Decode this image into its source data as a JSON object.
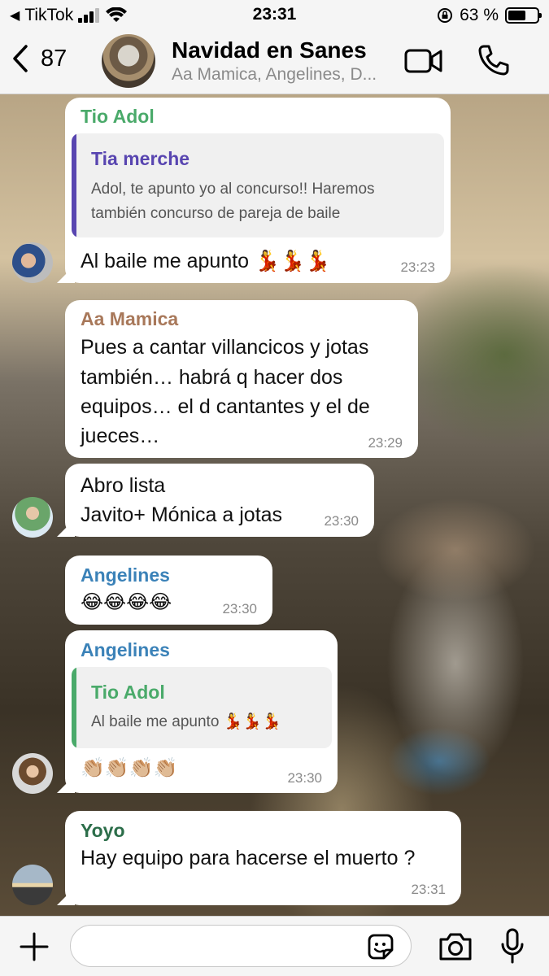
{
  "status_bar": {
    "back_app": "TikTok",
    "time": "23:31",
    "battery": "63 %",
    "battery_level": 0.63
  },
  "header": {
    "unread_count": "87",
    "title": "Navidad en Sanes",
    "subtitle": "Aa Mamica, Angelines, D..."
  },
  "colors": {
    "tio_adol": "#4aaa6a",
    "tia_merche": "#5845b0",
    "aa_mamica": "#a8785a",
    "angelines": "#3b82b8",
    "yoyo": "#2c6e4a"
  },
  "messages": [
    {
      "sender": "Tio Adol",
      "quote_sender": "Tia merche",
      "quote_text_1": "Adol, te apunto yo al concurso!! Haremos",
      "quote_text_2": "también concurso de pareja de baile",
      "text": "Al baile me apunto 💃💃💃",
      "time": "23:23"
    },
    {
      "sender": "Aa Mamica",
      "line_1": "Pues a cantar villancicos y jotas",
      "line_2": "también… habrá q hacer dos",
      "line_3": "equipos… el d cantantes y el de",
      "line_4": "jueces…",
      "time": "23:29"
    },
    {
      "line_1": "Abro lista",
      "line_2": "Javito+ Mónica a jotas",
      "time": "23:30"
    },
    {
      "sender": "Angelines",
      "text": "😂😂😂😂",
      "time": "23:30"
    },
    {
      "sender": "Angelines",
      "quote_sender": "Tio Adol",
      "quote_text": "Al baile me apunto 💃💃💃",
      "text": "👏🏼👏🏼👏🏼👏🏼",
      "time": "23:30"
    },
    {
      "sender": "Yoyo",
      "text": "Hay equipo para hacerse el muerto ?",
      "time": "23:31"
    }
  ],
  "input": {
    "placeholder": ""
  }
}
